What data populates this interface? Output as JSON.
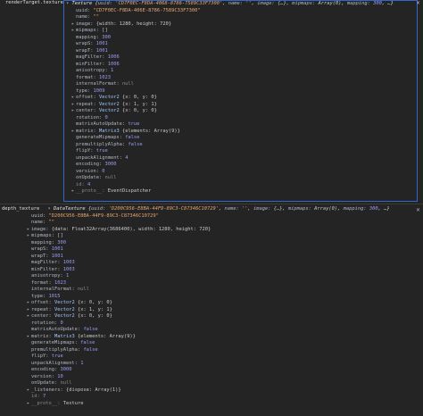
{
  "panels": [
    {
      "label": "renderTarget.texture",
      "header": {
        "type_name": "Texture",
        "open": "{",
        "preview": [
          {
            "k": "uuid",
            "v": "'CD7F0EC-F8DA-4068-8786-7589C33F7300'",
            "t": "str"
          },
          {
            "k": "name",
            "v": "''",
            "t": "str"
          },
          {
            "k": "image",
            "v": "{…}",
            "t": "sub"
          },
          {
            "k": "mipmaps",
            "v": "Array(0)",
            "t": "sub"
          },
          {
            "k": "mapping",
            "v": "300",
            "t": "num"
          }
        ],
        "tail": "…}"
      },
      "lines": [
        {
          "key": "uuid",
          "val": "\"CD7F0EC-F8DA-406E-8786-7589C33F7300\"",
          "t": "str",
          "tri": false
        },
        {
          "key": "name",
          "val": "\"\"",
          "t": "str",
          "tri": false
        },
        {
          "key": "image",
          "val": "{width: 1280, height: 720}",
          "t": "sub",
          "tri": true
        },
        {
          "key": "mipmaps",
          "val": "[]",
          "t": "sub",
          "tri": true
        },
        {
          "key": "mapping",
          "val": "300",
          "t": "num",
          "tri": false
        },
        {
          "key": "wrapS",
          "val": "1001",
          "t": "num",
          "tri": false
        },
        {
          "key": "wrapT",
          "val": "1001",
          "t": "num",
          "tri": false
        },
        {
          "key": "magFilter",
          "val": "1006",
          "t": "num",
          "tri": false
        },
        {
          "key": "minFilter",
          "val": "1006",
          "t": "num",
          "tri": false
        },
        {
          "key": "anisotropy",
          "val": "1",
          "t": "num",
          "tri": false
        },
        {
          "key": "format",
          "val": "1023",
          "t": "num",
          "tri": false
        },
        {
          "key": "internalFormat",
          "val": "null",
          "t": "nul",
          "tri": false
        },
        {
          "key": "type",
          "val": "1009",
          "t": "num",
          "tri": false
        },
        {
          "key": "offset",
          "cls": "Vector2",
          "val": "{x: 0, y: 0}",
          "t": "sub",
          "tri": true
        },
        {
          "key": "repeat",
          "cls": "Vector2",
          "val": "{x: 1, y: 1}",
          "t": "sub",
          "tri": true
        },
        {
          "key": "center",
          "cls": "Vector2",
          "val": "{x: 0, y: 0}",
          "t": "sub",
          "tri": true
        },
        {
          "key": "rotation",
          "val": "0",
          "t": "num",
          "tri": false
        },
        {
          "key": "matrixAutoUpdate",
          "val": "true",
          "t": "bool",
          "tri": false
        },
        {
          "key": "matrix",
          "cls": "Matrix3",
          "val": "{elements: Array(9)}",
          "t": "sub",
          "tri": true
        },
        {
          "key": "generateMipmaps",
          "val": "false",
          "t": "bool",
          "tri": false
        },
        {
          "key": "premultiplyAlpha",
          "val": "false",
          "t": "bool",
          "tri": false
        },
        {
          "key": "flipY",
          "val": "true",
          "t": "bool",
          "tri": false
        },
        {
          "key": "unpackAlignment",
          "val": "4",
          "t": "num",
          "tri": false
        },
        {
          "key": "encoding",
          "val": "3000",
          "t": "num",
          "tri": false
        },
        {
          "key": "version",
          "val": "0",
          "t": "num",
          "tri": false
        },
        {
          "key": "onUpdate",
          "val": "null",
          "t": "nul",
          "tri": false
        },
        {
          "key": "id",
          "val": "4",
          "t": "num",
          "tri": false,
          "dim": true
        },
        {
          "key": "__proto__",
          "val": "EventDispatcher",
          "t": "sub",
          "tri": true,
          "dim": true
        }
      ]
    },
    {
      "label": "depth_texture",
      "header": {
        "type_name": "DataTexture",
        "open": "{",
        "preview": [
          {
            "k": "uuid",
            "v": "'D200C956-E8BA-44F9-89C3-C87346C10729'",
            "t": "str"
          },
          {
            "k": "name",
            "v": "''",
            "t": "str"
          },
          {
            "k": "image",
            "v": "{…}",
            "t": "sub"
          },
          {
            "k": "mipmaps",
            "v": "Array(0)",
            "t": "sub"
          },
          {
            "k": "mapping",
            "v": "300",
            "t": "num"
          }
        ],
        "tail": "…}"
      },
      "lines": [
        {
          "key": "uuid",
          "val": "\"D200C956-E8BA-44F9-89C3-C87346C10729\"",
          "t": "str",
          "tri": false
        },
        {
          "key": "name",
          "val": "\"\"",
          "t": "str",
          "tri": false
        },
        {
          "key": "image",
          "val": "{data: Float32Array(3686400), width: 1280, height: 720}",
          "t": "sub",
          "tri": true
        },
        {
          "key": "mipmaps",
          "val": "[]",
          "t": "sub",
          "tri": true
        },
        {
          "key": "mapping",
          "val": "300",
          "t": "num",
          "tri": false
        },
        {
          "key": "wrapS",
          "val": "1001",
          "t": "num",
          "tri": false
        },
        {
          "key": "wrapT",
          "val": "1001",
          "t": "num",
          "tri": false
        },
        {
          "key": "magFilter",
          "val": "1003",
          "t": "num",
          "tri": false
        },
        {
          "key": "minFilter",
          "val": "1003",
          "t": "num",
          "tri": false
        },
        {
          "key": "anisotropy",
          "val": "1",
          "t": "num",
          "tri": false
        },
        {
          "key": "format",
          "val": "1023",
          "t": "num",
          "tri": false
        },
        {
          "key": "internalFormat",
          "val": "null",
          "t": "nul",
          "tri": false
        },
        {
          "key": "type",
          "val": "1015",
          "t": "num",
          "tri": false
        },
        {
          "key": "offset",
          "cls": "Vector2",
          "val": "{x: 0, y: 0}",
          "t": "sub",
          "tri": true
        },
        {
          "key": "repeat",
          "cls": "Vector2",
          "val": "{x: 1, y: 1}",
          "t": "sub",
          "tri": true
        },
        {
          "key": "center",
          "cls": "Vector2",
          "val": "{x: 0, y: 0}",
          "t": "sub",
          "tri": true
        },
        {
          "key": "rotation",
          "val": "0",
          "t": "num",
          "tri": false
        },
        {
          "key": "matrixAutoUpdate",
          "val": "false",
          "t": "bool",
          "tri": false
        },
        {
          "key": "matrix",
          "cls": "Matrix3",
          "val": "{elements: Array(9)}",
          "t": "sub",
          "tri": true
        },
        {
          "key": "generateMipmaps",
          "val": "false",
          "t": "bool",
          "tri": false
        },
        {
          "key": "premultiplyAlpha",
          "val": "false",
          "t": "bool",
          "tri": false
        },
        {
          "key": "flipY",
          "val": "true",
          "t": "bool",
          "tri": false
        },
        {
          "key": "unpackAlignment",
          "val": "1",
          "t": "num",
          "tri": false
        },
        {
          "key": "encoding",
          "val": "3000",
          "t": "num",
          "tri": false
        },
        {
          "key": "version",
          "val": "10",
          "t": "num",
          "tri": false
        },
        {
          "key": "onUpdate",
          "val": "null",
          "t": "nul",
          "tri": false
        },
        {
          "key": "_listeners",
          "val": "{dispose: Array(1)}",
          "t": "sub",
          "tri": true
        },
        {
          "key": "id",
          "val": "7",
          "t": "num",
          "tri": false,
          "dim": true
        },
        {
          "key": "__proto__",
          "val": "Texture",
          "t": "sub",
          "tri": true,
          "dim": true
        }
      ]
    }
  ],
  "colors": {
    "border": "#2f68c8",
    "string": "#e8a56d",
    "number": "#9a9cf5",
    "key": "#b0b7c3"
  },
  "icons": {
    "expand": "triangle-right-icon",
    "collapse": "triangle-down-icon",
    "close": "close-icon"
  }
}
